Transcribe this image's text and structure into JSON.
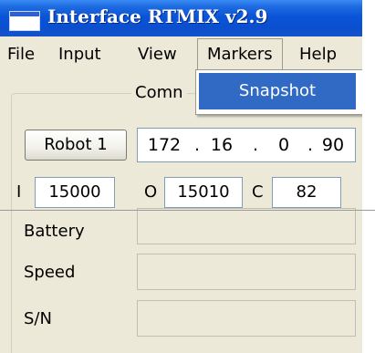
{
  "window": {
    "title": "Interface RTMIX v2.9"
  },
  "menu": {
    "items": [
      "File",
      "Input",
      "View",
      "Markers",
      "Help"
    ],
    "active": "Markers",
    "dropdown": [
      "Snapshot"
    ]
  },
  "group": {
    "legend": "Comn"
  },
  "robot_button": "Robot 1",
  "ip": [
    "172",
    "16",
    "0",
    "90"
  ],
  "ports": {
    "i_label": "I",
    "i_value": "15000",
    "o_label": "O",
    "o_value": "15010",
    "c_label": "C",
    "c_value": "82"
  },
  "fields": [
    {
      "label": "Battery",
      "value": ""
    },
    {
      "label": "Speed",
      "value": ""
    },
    {
      "label": "S/N",
      "value": ""
    }
  ],
  "colors": {
    "titlebar": "#0a54d8",
    "menu_highlight": "#316ac5",
    "window_bg": "#ece9d8"
  }
}
